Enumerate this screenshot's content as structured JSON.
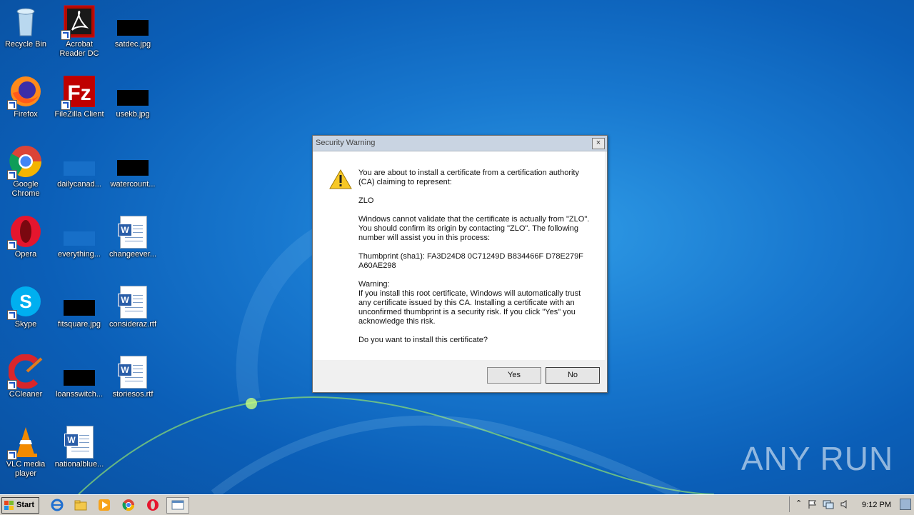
{
  "desktop": {
    "icons": [
      {
        "label": "Recycle Bin"
      },
      {
        "label": "Acrobat Reader DC"
      },
      {
        "label": "satdec.jpg"
      },
      {
        "label": "Firefox"
      },
      {
        "label": "FileZilla Client"
      },
      {
        "label": "usekb.jpg"
      },
      {
        "label": "Google Chrome"
      },
      {
        "label": "dailycanad..."
      },
      {
        "label": "watercount..."
      },
      {
        "label": "Opera"
      },
      {
        "label": "everything..."
      },
      {
        "label": "changeever..."
      },
      {
        "label": "Skype"
      },
      {
        "label": "fitsquare.jpg"
      },
      {
        "label": "consideraz.rtf"
      },
      {
        "label": "CCleaner"
      },
      {
        "label": "loansswitch..."
      },
      {
        "label": "storiesos.rtf"
      },
      {
        "label": "VLC media player"
      },
      {
        "label": "nationalblue..."
      }
    ]
  },
  "dialog": {
    "title": "Security Warning",
    "close_glyph": "×",
    "p1": "You are about to install a certificate from a certification authority (CA) claiming to represent:",
    "ca_name": "ZLO",
    "p2": "Windows cannot validate that the certificate is actually from \"ZLO\". You should confirm its origin by contacting \"ZLO\". The following number will assist you in this process:",
    "thumbprint": "Thumbprint (sha1): FA3D24D8 0C71249D B834466F D78E279F A60AE298",
    "warning_heading": "Warning:",
    "warning_text": "If you install this root certificate, Windows will automatically trust any certificate issued by this CA. Installing a certificate with an unconfirmed thumbprint is a security risk. If you click \"Yes\" you acknowledge this risk.",
    "question": "Do you want to install this certificate?",
    "yes_label": "Yes",
    "no_label": "No"
  },
  "taskbar": {
    "start_label": "Start",
    "clock": "9:12 PM"
  },
  "watermark": "ANY RUN"
}
